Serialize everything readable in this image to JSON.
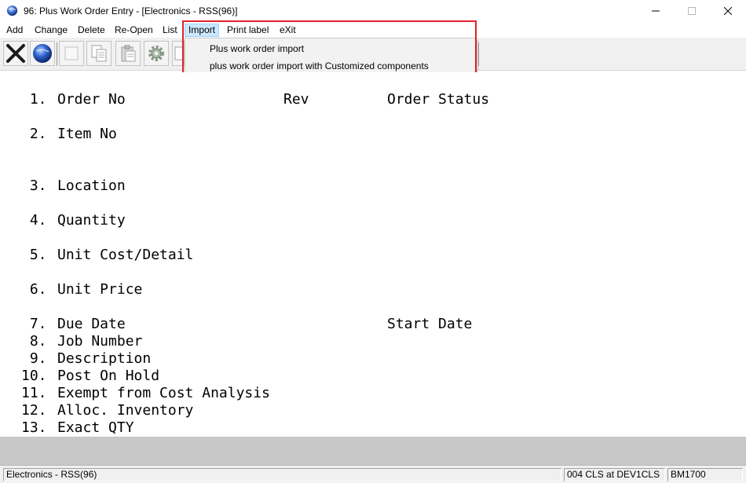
{
  "window": {
    "title": "96: Plus Work Order Entry - [Electronics - RSS(96)]"
  },
  "menu": {
    "items": [
      {
        "label": "Add"
      },
      {
        "label": "Change"
      },
      {
        "label": "Delete"
      },
      {
        "label": "Re-Open"
      },
      {
        "label": "List"
      },
      {
        "label": "Import"
      },
      {
        "label": "Print label"
      },
      {
        "label": "eXit"
      }
    ],
    "active": "Import"
  },
  "toolbar": {
    "buttons": [
      {
        "icon": "close-x-icon"
      },
      {
        "icon": "globe-icon"
      },
      {
        "icon": "blank-page-icon"
      },
      {
        "icon": "copy-documents-icon"
      },
      {
        "icon": "clipboard-icon"
      },
      {
        "icon": "settings-gear-icon"
      },
      {
        "icon": "document-icon"
      }
    ]
  },
  "import_menu": {
    "items": [
      {
        "label": "Plus work order import"
      },
      {
        "label": "plus work order import with Customized components"
      }
    ]
  },
  "form": {
    "fields": [
      {
        "num": " 1.",
        "label": "Order No"
      },
      {
        "num": " 2.",
        "label": "Item No"
      },
      {
        "num": " 3.",
        "label": "Location"
      },
      {
        "num": " 4.",
        "label": "Quantity"
      },
      {
        "num": " 5.",
        "label": "Unit Cost/Detail"
      },
      {
        "num": " 6.",
        "label": "Unit Price"
      },
      {
        "num": " 7.",
        "label": "Due Date"
      },
      {
        "num": " 8.",
        "label": "Job Number"
      },
      {
        "num": " 9.",
        "label": "Description"
      },
      {
        "num": "10.",
        "label": "Post On Hold"
      },
      {
        "num": "11.",
        "label": "Exempt from Cost Analysis"
      },
      {
        "num": "12.",
        "label": "Alloc. Inventory"
      },
      {
        "num": "13.",
        "label": "Exact QTY"
      }
    ],
    "rev_label": "Rev",
    "order_status_label": "Order Status",
    "start_date_label": "Start Date"
  },
  "status": {
    "company": "Electronics - RSS(96)",
    "session": "004 CLS at DEV1CLS",
    "program": "BM1700"
  },
  "colors": {
    "highlight_border": "#e0202a",
    "menu_active_bg": "#cce8ff"
  }
}
